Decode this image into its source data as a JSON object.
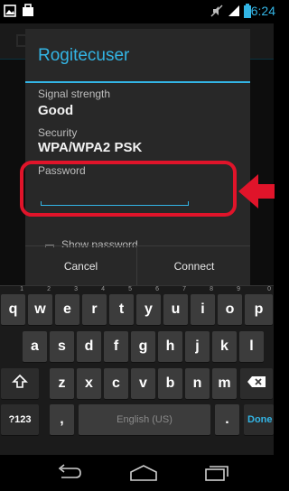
{
  "status_bar": {
    "time": "6:24",
    "left_icons": [
      "image-notification-icon",
      "briefcase-notification-icon"
    ],
    "right_icons": [
      "muted-icon",
      "signal-icon",
      "battery-icon"
    ]
  },
  "dialog": {
    "title": "Rogitecuser",
    "signal_label": "Signal strength",
    "signal_value": "Good",
    "security_label": "Security",
    "security_value": "WPA/WPA2 PSK",
    "password_label": "Password",
    "password_value": "",
    "show_password_label": "Show password",
    "cancel_label": "Cancel",
    "connect_label": "Connect"
  },
  "annotation": {
    "color": "#e0142a",
    "arrow_direction": "left"
  },
  "keyboard": {
    "row1": [
      {
        "label": "q",
        "hint": "1"
      },
      {
        "label": "w",
        "hint": "2"
      },
      {
        "label": "e",
        "hint": "3"
      },
      {
        "label": "r",
        "hint": "4"
      },
      {
        "label": "t",
        "hint": "5"
      },
      {
        "label": "y",
        "hint": "6"
      },
      {
        "label": "u",
        "hint": "7"
      },
      {
        "label": "i",
        "hint": "8"
      },
      {
        "label": "o",
        "hint": "9"
      },
      {
        "label": "p",
        "hint": "0"
      }
    ],
    "row2": [
      "a",
      "s",
      "d",
      "f",
      "g",
      "h",
      "j",
      "k",
      "l"
    ],
    "row3": [
      "z",
      "x",
      "c",
      "v",
      "b",
      "n",
      "m"
    ],
    "shift_icon": "shift-icon",
    "delete_icon": "backspace-icon",
    "symbols_label": "?123",
    "comma_label": ",",
    "space_label": "English (US)",
    "period_label": ".",
    "done_label": "Done"
  },
  "nav_bar": {
    "icons": [
      "back-icon",
      "home-icon",
      "recent-apps-icon"
    ]
  },
  "colors": {
    "accent": "#33b5e5",
    "dialog_bg": "#282828",
    "key_bg": "#3c3c3c",
    "annotation_red": "#e0142a"
  }
}
